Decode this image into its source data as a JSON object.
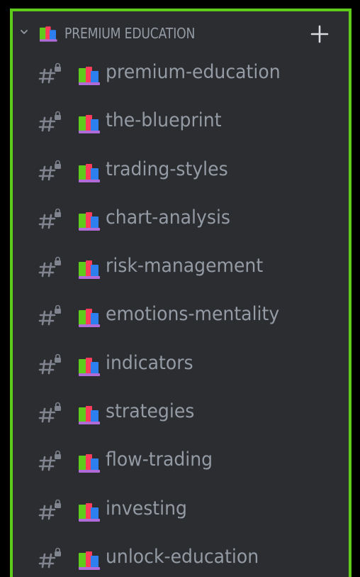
{
  "category": {
    "label": "PREMIUM EDUCATION",
    "icons": {
      "collapse": "chevron-down-icon",
      "emoji": "books-emoji-icon",
      "add": "plus-icon"
    }
  },
  "channel_icon": "locked-hash-icon",
  "channel_emoji": "books-emoji-icon",
  "channels": [
    {
      "label": "premium-education"
    },
    {
      "label": "the-blueprint"
    },
    {
      "label": "trading-styles"
    },
    {
      "label": "chart-analysis"
    },
    {
      "label": "risk-management"
    },
    {
      "label": "emotions-mentality"
    },
    {
      "label": "indicators"
    },
    {
      "label": "strategies"
    },
    {
      "label": "flow-trading"
    },
    {
      "label": "investing"
    },
    {
      "label": "unlock-education"
    }
  ],
  "colors": {
    "background": "#2b2d31",
    "border": "#5fcc1c",
    "text": "#949ba4"
  }
}
